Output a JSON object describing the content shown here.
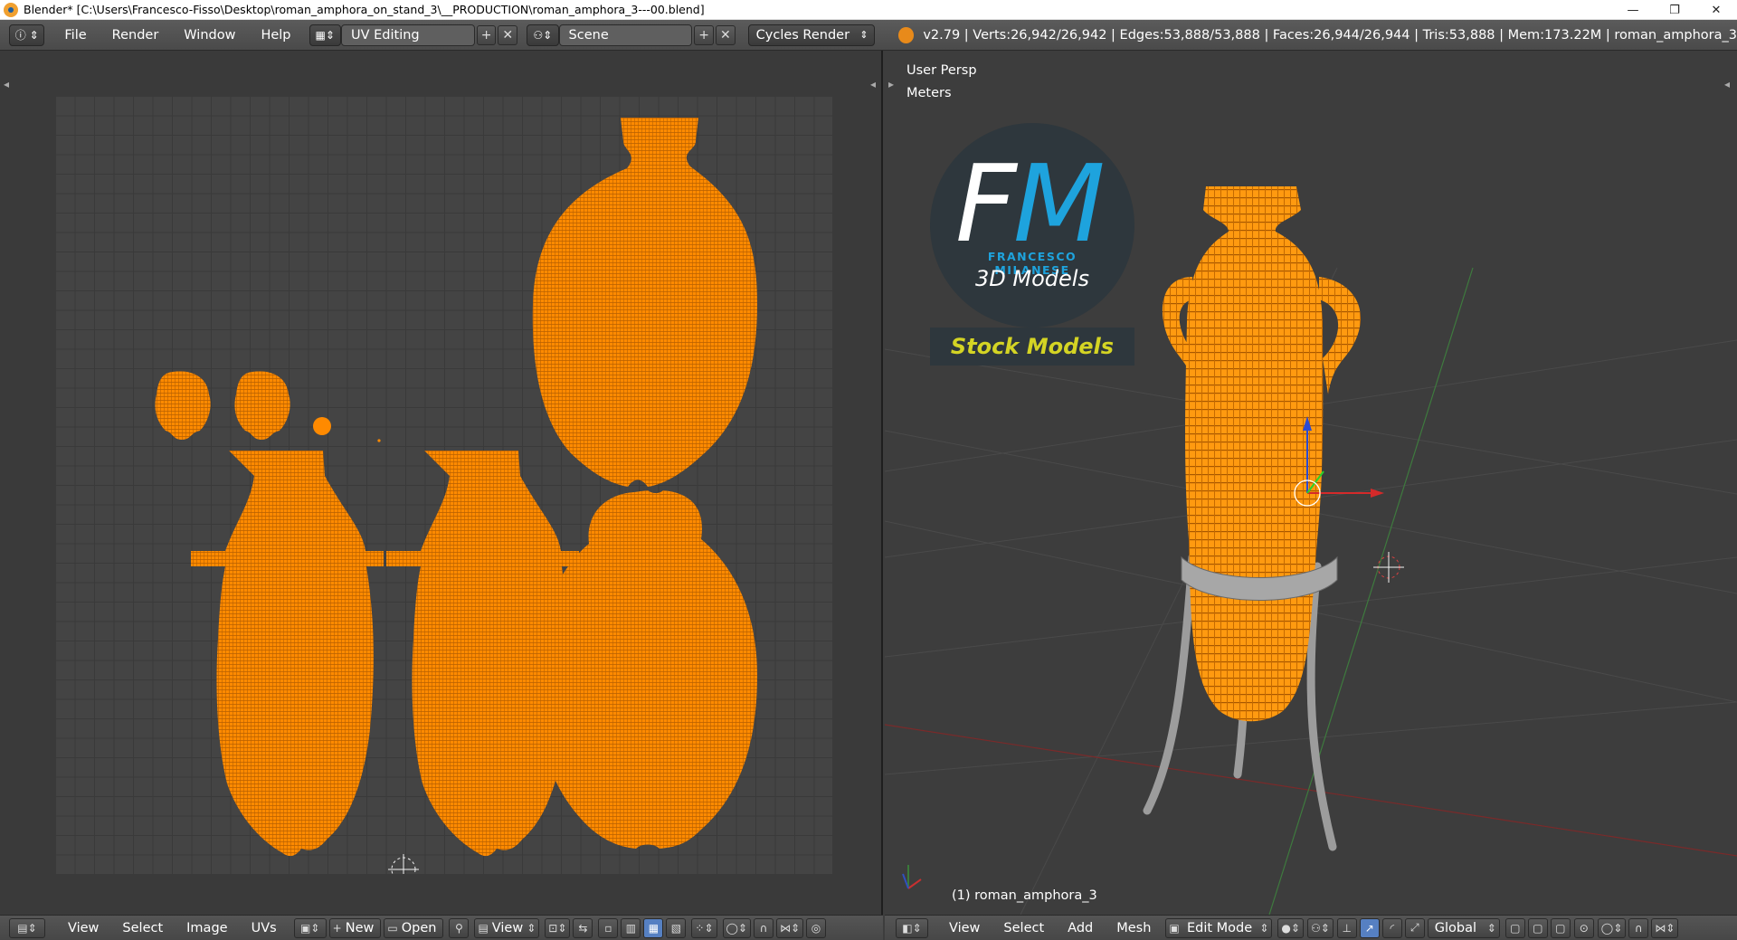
{
  "window": {
    "title": "Blender* [C:\\Users\\Francesco-Fisso\\Desktop\\roman_amphora_on_stand_3\\__PRODUCTION\\roman_amphora_3---00.blend]",
    "minimize": "—",
    "maximize": "❐",
    "close": "✕"
  },
  "topbar": {
    "menus": [
      "File",
      "Render",
      "Window",
      "Help"
    ],
    "screen_layout": "UV Editing",
    "scene": "Scene",
    "render_engine": "Cycles Render",
    "stats": "v2.79 | Verts:26,942/26,942 | Edges:53,888/53,888 | Faces:26,944/26,944 | Tris:53,888 | Mem:173.22M | roman_amphora_3"
  },
  "viewport": {
    "view_name": "User Persp",
    "units": "Meters",
    "object_label": "(1) roman_amphora_3",
    "logo_name": "FRANCESCO MILANESE",
    "logo_sub": "3D Models",
    "logo_stock": "Stock Models"
  },
  "uv_bottom": {
    "menus": [
      "View",
      "Select",
      "Image",
      "UVs"
    ],
    "new_label": "New",
    "open_label": "Open",
    "view_label": "View"
  },
  "view3d_bottom": {
    "menus": [
      "View",
      "Select",
      "Add",
      "Mesh"
    ],
    "mode": "Edit Mode",
    "orientation": "Global"
  },
  "colors": {
    "mesh_orange": "#ff8a00",
    "grid_bg": "#444444",
    "logo_blue": "#1ea3dd",
    "logo_yellow": "#d4d424"
  }
}
